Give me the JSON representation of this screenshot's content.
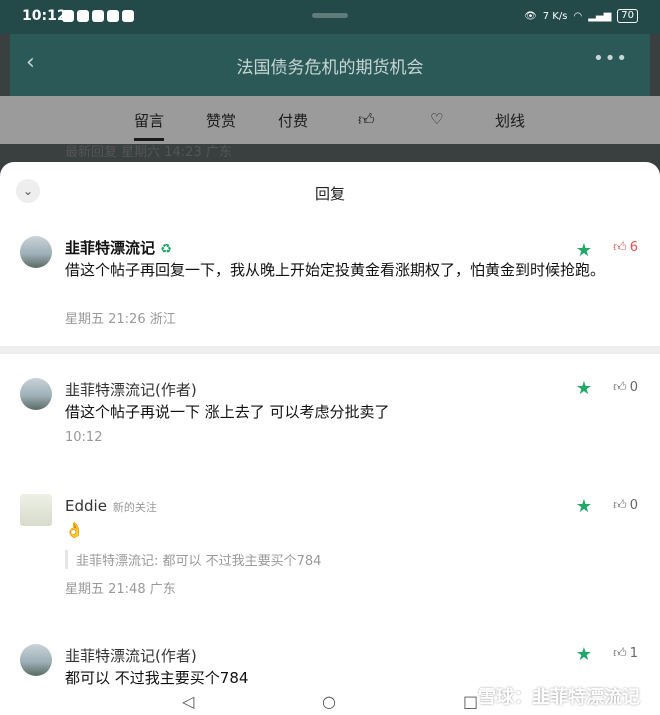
{
  "status": {
    "time": "10:12",
    "speed": "7 K/s",
    "battery": "70"
  },
  "appbar": {
    "title": "法国债务危机的期货机会"
  },
  "tabs": [
    "留言",
    "赞赏",
    "付费",
    "划线"
  ],
  "peek": "最新回复 星期六 14:23 广东",
  "sheet": {
    "title": "回复"
  },
  "comments": [
    {
      "name": "韭菲特漂流记",
      "body": "借这个帖子再回复一下，我从晚上开始定投黄金看涨期权了，怕黄金到时候抢跑。",
      "meta": "星期五 21:26 浙江",
      "likes": "6"
    },
    {
      "name": "韭菲特漂流记(作者)",
      "body": "借这个帖子再说一下 涨上去了 可以考虑分批卖了",
      "meta": "10:12",
      "likes": "0"
    },
    {
      "name": "Eddie",
      "tag": "新的关注",
      "body": "👌",
      "quote": "韭菲特漂流记: 都可以 不过我主要买个784",
      "meta": "星期五 21:48 广东",
      "likes": "0"
    },
    {
      "name": "韭菲特漂流记(作者)",
      "body": "都可以 不过我主要买个784",
      "likes": "1"
    }
  ],
  "watermark": "雪球：韭菲特漂流记"
}
